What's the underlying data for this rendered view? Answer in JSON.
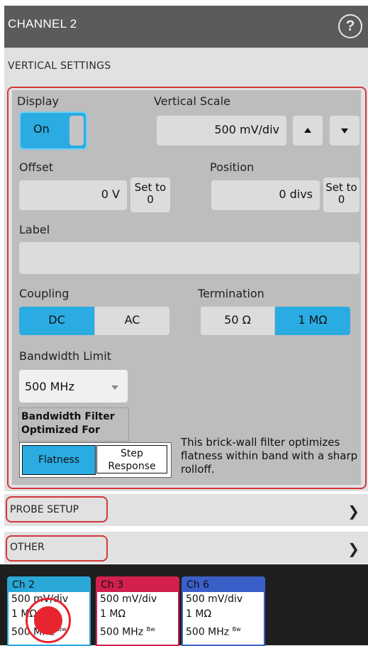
{
  "header": {
    "title": "CHANNEL 2",
    "help_icon": "?"
  },
  "vertical_settings": {
    "title": "VERTICAL SETTINGS"
  },
  "display": {
    "label": "Display",
    "state": "On"
  },
  "vertical_scale": {
    "label": "Vertical Scale",
    "value": "500 mV/div"
  },
  "offset": {
    "label": "Offset",
    "value": "0 V",
    "set_zero": "Set to 0"
  },
  "position": {
    "label": "Position",
    "value": "0 divs",
    "set_zero": "Set to 0"
  },
  "label_field": {
    "label": "Label",
    "value": ""
  },
  "coupling": {
    "label": "Coupling",
    "options": [
      "DC",
      "AC"
    ],
    "selected": "DC"
  },
  "termination": {
    "label": "Termination",
    "options": [
      "50 Ω",
      "1 MΩ"
    ],
    "selected": "1 MΩ"
  },
  "bandwidth": {
    "label": "Bandwidth Limit",
    "value": "500 MHz",
    "filter_label": "Bandwidth Filter Optimized For",
    "options": [
      "Flatness",
      "Step Response"
    ],
    "selected": "Flatness",
    "description": "This brick-wall filter optimizes flatness within band with a sharp rolloff."
  },
  "sections": {
    "probe_setup": "PROBE SETUP",
    "other": "OTHER"
  },
  "channels": [
    {
      "name": "Ch 2",
      "scale": "500 mV/div",
      "impedance": "1 MΩ",
      "bandwidth": "500 MHz",
      "bw_mark": "Bw",
      "color": "#2aa7d6",
      "active": true
    },
    {
      "name": "Ch 3",
      "scale": "500 mV/div",
      "impedance": "1 MΩ",
      "bandwidth": "500 MHz",
      "bw_mark": "Bw",
      "color": "#d21f4c",
      "active": false
    },
    {
      "name": "Ch 6",
      "scale": "500 mV/div",
      "impedance": "1 MΩ",
      "bandwidth": "500 MHz",
      "bw_mark": "Bw",
      "color": "#3b5fc9",
      "active": false
    }
  ]
}
